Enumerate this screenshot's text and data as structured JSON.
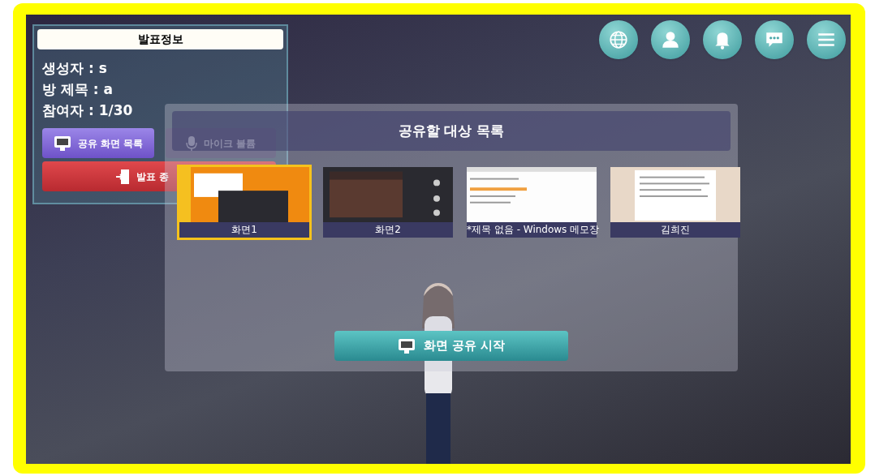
{
  "info_panel": {
    "title": "발표정보",
    "lines": [
      "생성자 : s",
      "방 제목 : a",
      "참여자 : 1/30"
    ],
    "buttons": [
      {
        "kind": "share_list",
        "label": "공유 화면 목록",
        "disabled": false
      },
      {
        "kind": "mic",
        "label": "마이크 볼륨",
        "disabled": true
      },
      {
        "kind": "end",
        "label": "발표 종",
        "disabled": false
      }
    ]
  },
  "dialog": {
    "title": "공유할 대상 목록",
    "targets": [
      {
        "kind": "desktop",
        "label": "화면1",
        "selected": true
      },
      {
        "kind": "game",
        "label": "화면2",
        "selected": false
      },
      {
        "kind": "notepad",
        "label": "*제목 없음 - Windows 메모장",
        "selected": false
      },
      {
        "kind": "document",
        "label": "김희진",
        "selected": false
      }
    ],
    "start_button": "화면 공유 시작"
  }
}
